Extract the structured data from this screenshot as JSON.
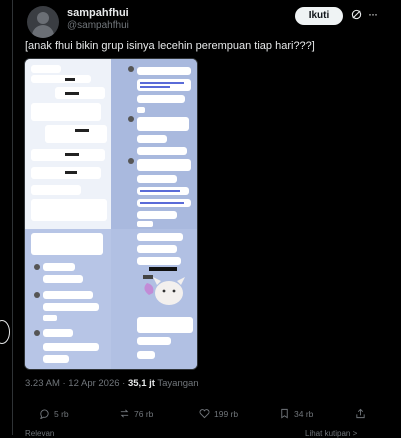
{
  "tweet": {
    "display_name": "sampahfhui",
    "handle": "@sampahfhui",
    "follow_label": "Ikuti",
    "text": "[anak fhui bikin grup isinya lecehin perempuan tiap hari???]",
    "time": "3.23 AM · 12 Apr 2026 · ",
    "views_count": "35,1 jt",
    "views_label": " Tayangan",
    "replies": "5 rb",
    "reposts": "76 rb",
    "likes": "199 rb",
    "bookmarks": "34 rb",
    "footer_left": "Relevan",
    "footer_right": "Lihat kutipan >"
  },
  "icons": {
    "more": "more-icon",
    "grok": "grok-icon",
    "reply": "reply-icon",
    "repost": "repost-icon",
    "like": "like-icon",
    "bookmark": "bookmark-icon",
    "share": "share-icon"
  },
  "colors": {
    "background": "#000000",
    "text": "#e7e9ea",
    "muted": "#71767b",
    "chat_bg": "#c8d3ea"
  },
  "chat": {
    "left_panel_bubbles": [
      "",
      "",
      "",
      "",
      "",
      "",
      "",
      "",
      "",
      "Waktu gw ke ig sksksnah tapi dari kalangan bugak hanyatu"
    ],
    "right_bubbles": [
      "Lagi dik cewekya ki",
      "PIYAMAYAAHAN MEREKA TANGANGGAL",
      "Inicio gue liats puitan 3",
      "Dari",
      "J/r sa S4ahO4",
      "Kalo pagaun qu dhorida diwapaa ICHRNA",
      "Bdoon perlima",
      "\"Jepes bersheh tibaruhan\"",
      "HAHAHAHAHAHAHAHAAAA",
      "Ento kwanh neosh",
      "Basil",
      "cuall aku pi bini lamal",
      "bencari 3 lani bgi",
      "3 batalig seks",
      "Bu kwil 4erfweingwl pa aku se berlaput penolakan rowih sini",
      "Uh jn seddi dit",
      "ahwe!"
    ],
    "left_bubbles": [
      "Waktu gw ke ig sksksn tapi dari kalangan bugak sis pamah",
      "bantuk w ga",
      "Pw tetangbung",
      "kalau t ampoung mbja",
      "hatan sabenlah baneh ga",
      "P!R.",
      "Cabit la cibe",
      "Emg bnp s/t ki bantuknya 9I",
      "Kan salena"
    ]
  }
}
